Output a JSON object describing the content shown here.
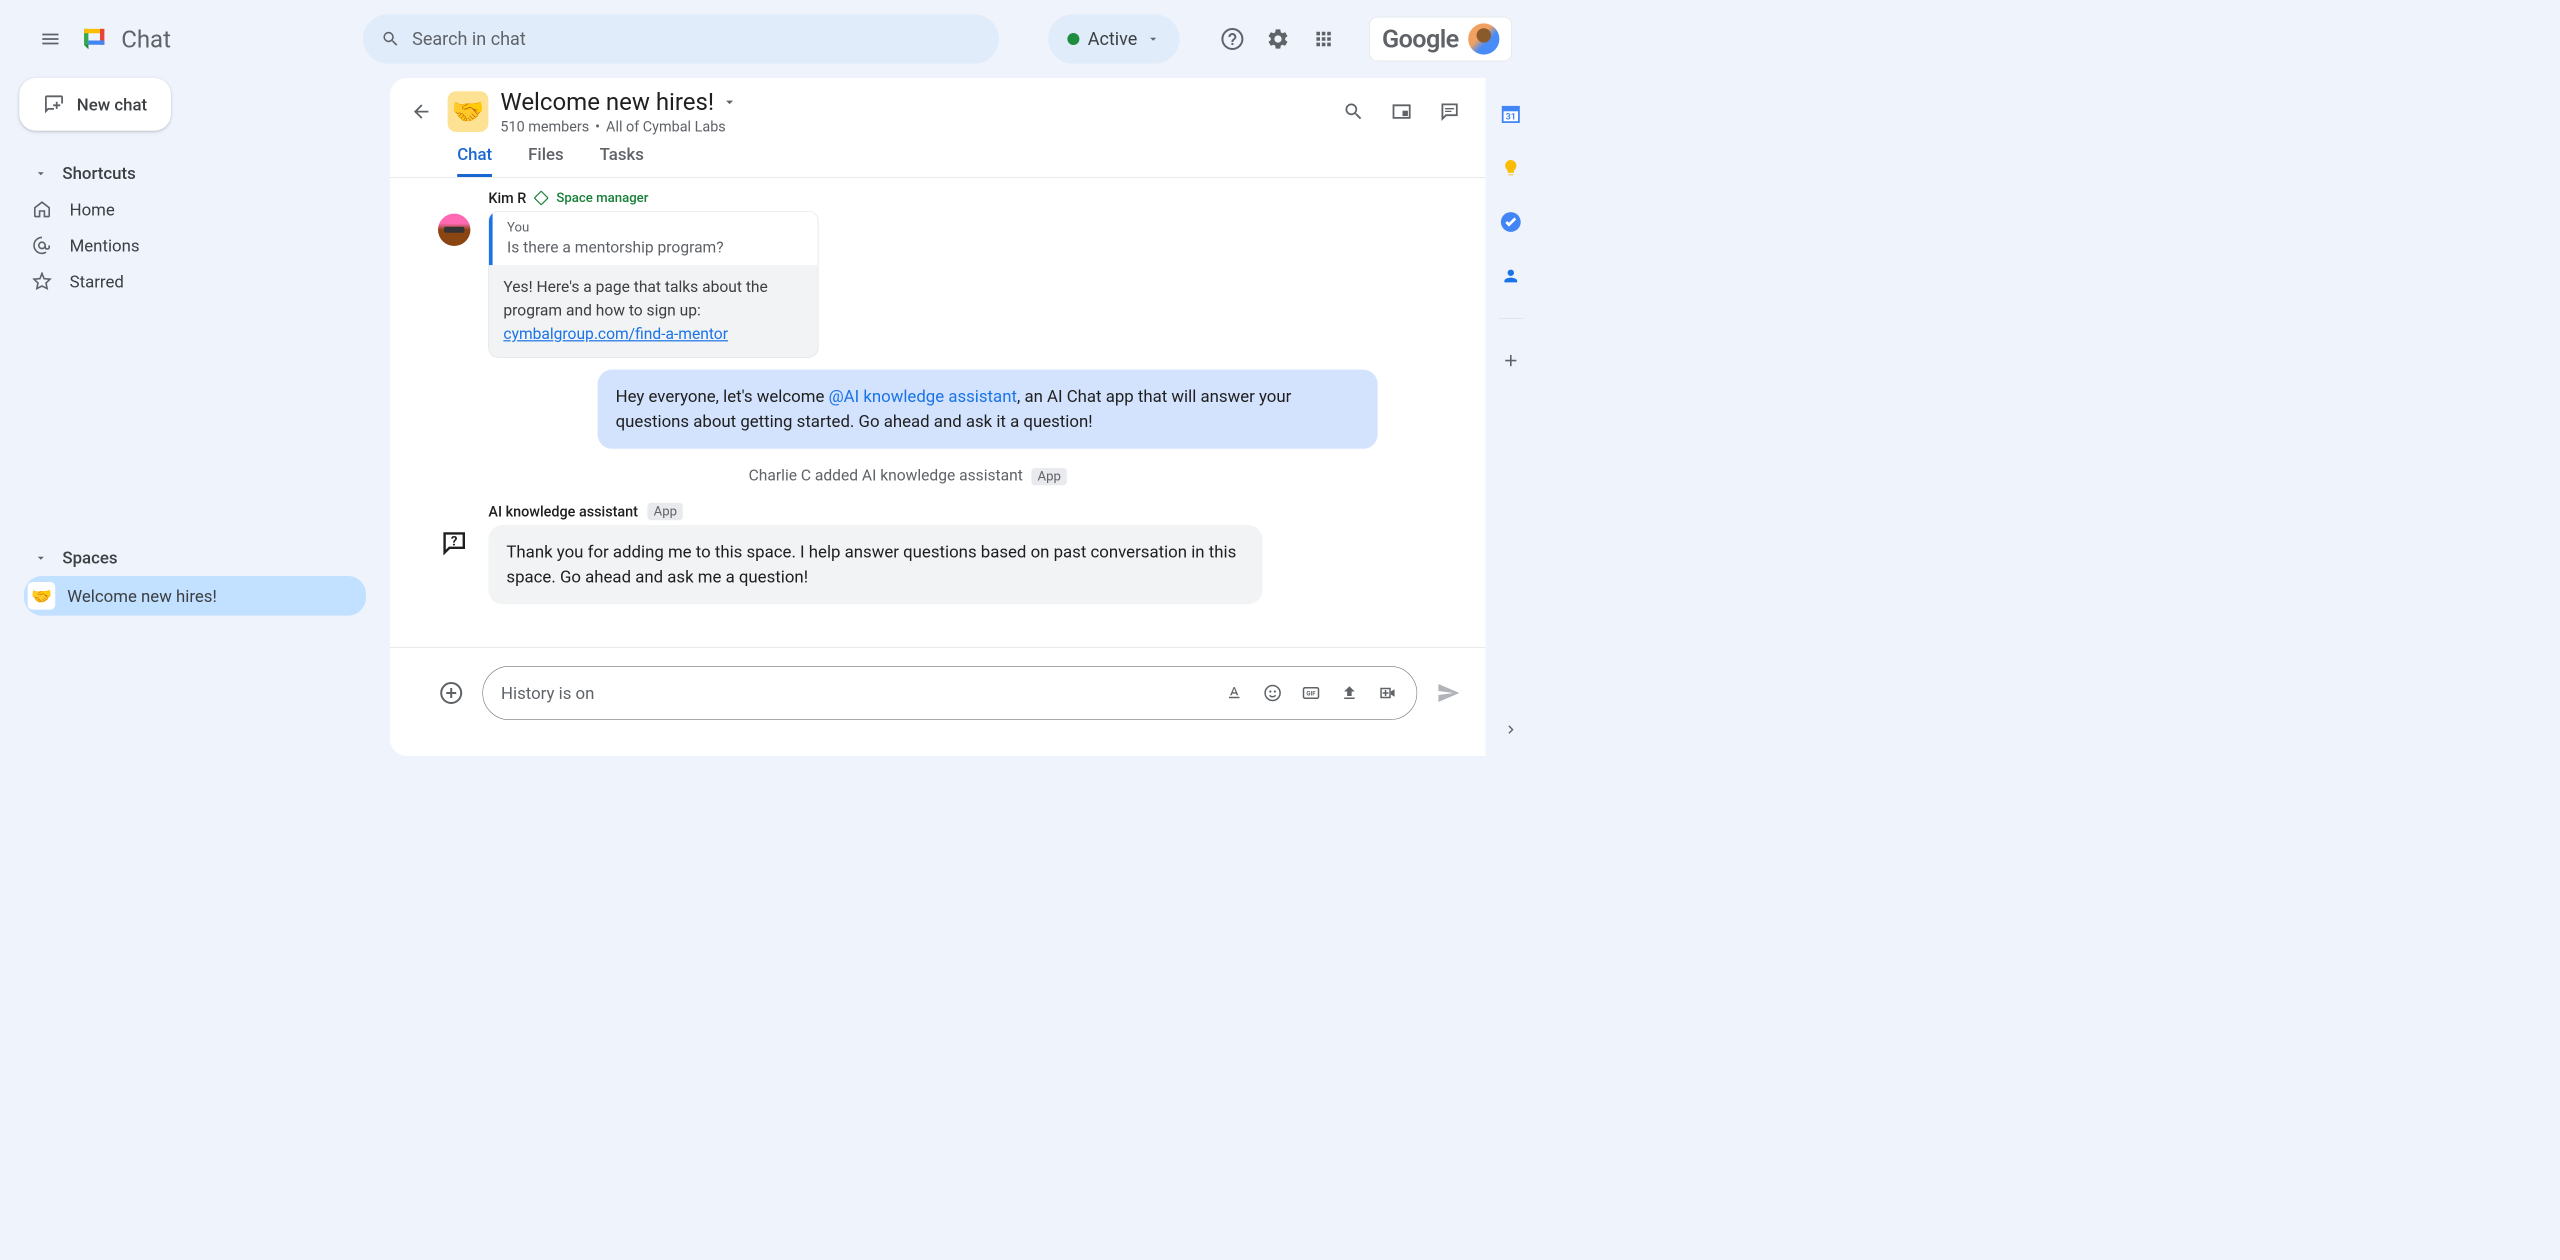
{
  "header": {
    "app_name": "Chat",
    "search_placeholder": "Search in chat",
    "status_label": "Active",
    "google_brand": "Google"
  },
  "sidebar": {
    "new_chat": "New chat",
    "shortcuts_label": "Shortcuts",
    "shortcuts": [
      {
        "icon": "home",
        "label": "Home"
      },
      {
        "icon": "at",
        "label": "Mentions"
      },
      {
        "icon": "star",
        "label": "Starred"
      }
    ],
    "spaces_label": "Spaces",
    "spaces": [
      {
        "emoji": "🤝",
        "label": "Welcome new hires!",
        "active": true
      }
    ]
  },
  "space": {
    "emoji": "🤝",
    "title": "Welcome new hires!",
    "members": "510 members",
    "scope": "All of Cymbal Labs",
    "tabs": [
      {
        "label": "Chat",
        "active": true
      },
      {
        "label": "Files",
        "active": false
      },
      {
        "label": "Tasks",
        "active": false
      }
    ]
  },
  "messages": {
    "kim": {
      "author": "Kim R",
      "role": "Space manager",
      "quote_author": "You",
      "quote_text": "Is there a mentorship program?",
      "reply_text": "Yes! Here's a page that talks about the program and how to sign up: ",
      "reply_link": "cymbalgroup.com/find-a-mentor"
    },
    "charlie": {
      "prefix": "Hey everyone, let's welcome ",
      "mention": "@AI knowledge assistant",
      "suffix": ", an AI Chat app that will answer your questions about getting started.  Go ahead and ask it a question!"
    },
    "system": {
      "text": "Charlie C added AI knowledge assistant",
      "badge": "App"
    },
    "bot": {
      "author": "AI knowledge assistant",
      "badge": "App",
      "text": "Thank you for adding me to this space. I help answer questions based on past conversation in this space. Go ahead and ask me a question!"
    }
  },
  "composer": {
    "placeholder": "History is on"
  }
}
